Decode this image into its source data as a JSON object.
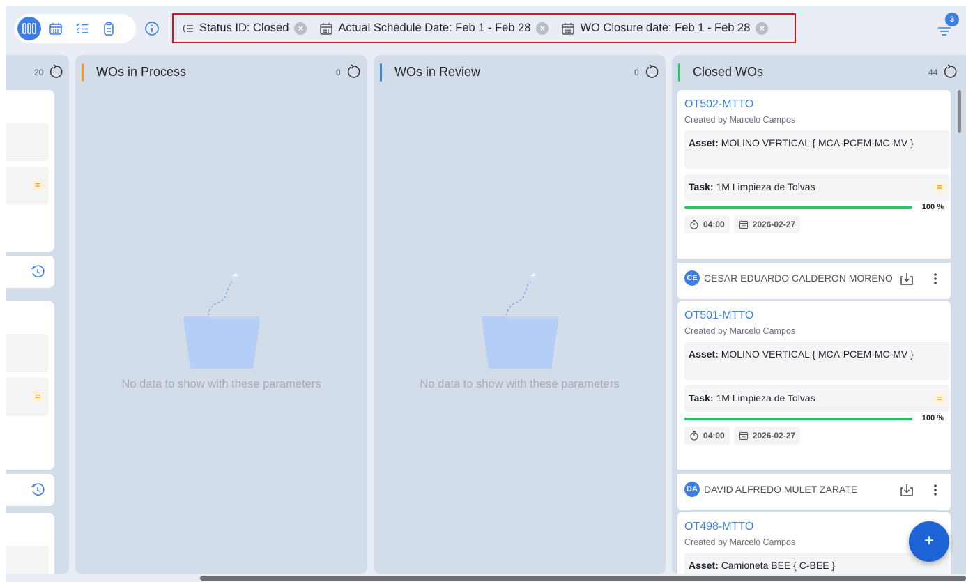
{
  "header": {
    "filters": [
      {
        "icon": "status-filter-icon",
        "label": "Status ID: Closed"
      },
      {
        "icon": "calendar-icon",
        "label": "Actual Schedule Date: Feb 1 - Feb 28"
      },
      {
        "icon": "calendar-icon",
        "label": "WO Closure date: Feb 1 - Feb 28"
      }
    ],
    "filter_count": "3"
  },
  "columns": {
    "partial": {
      "count": "20"
    },
    "in_process": {
      "title": "WOs in Process",
      "count": "0",
      "empty_text": "No data to show with these parameters",
      "accent": "#f39c2b"
    },
    "in_review": {
      "title": "WOs in Review",
      "count": "0",
      "empty_text": "No data to show with these parameters",
      "accent": "#3c7fe6"
    },
    "closed": {
      "title": "Closed WOs",
      "count": "44",
      "accent": "#22c55e"
    }
  },
  "cards": [
    {
      "wo": "OT502-MTTO",
      "created_by": "Created by Marcelo Campos",
      "asset_label": "Asset:",
      "asset": "MOLINO VERTICAL { MCA-PCEM-MC-MV }",
      "task_label": "Task:",
      "task": "1M Limpieza de Tolvas",
      "progress": 100,
      "progress_text": "100 %",
      "duration": "04:00",
      "date": "2026-02-27",
      "initials": "CE",
      "person": "CESAR EDUARDO CALDERON MORENO"
    },
    {
      "wo": "OT501-MTTO",
      "created_by": "Created by Marcelo Campos",
      "asset_label": "Asset:",
      "asset": "MOLINO VERTICAL { MCA-PCEM-MC-MV }",
      "task_label": "Task:",
      "task": "1M Limpieza de Tolvas",
      "progress": 100,
      "progress_text": "100 %",
      "duration": "04:00",
      "date": "2026-02-27",
      "initials": "DA",
      "person": "DAVID ALFREDO MULET ZARATE"
    },
    {
      "wo": "OT498-MTTO",
      "created_by": "Created by Marcelo Campos",
      "asset_label": "Asset:",
      "asset": "Camioneta BEE { C-BEE }"
    }
  ],
  "fab": {
    "label": "+"
  },
  "colors": {
    "primary": "#3c7fe6",
    "highlight_border": "#d9141d",
    "success": "#22c55e"
  }
}
